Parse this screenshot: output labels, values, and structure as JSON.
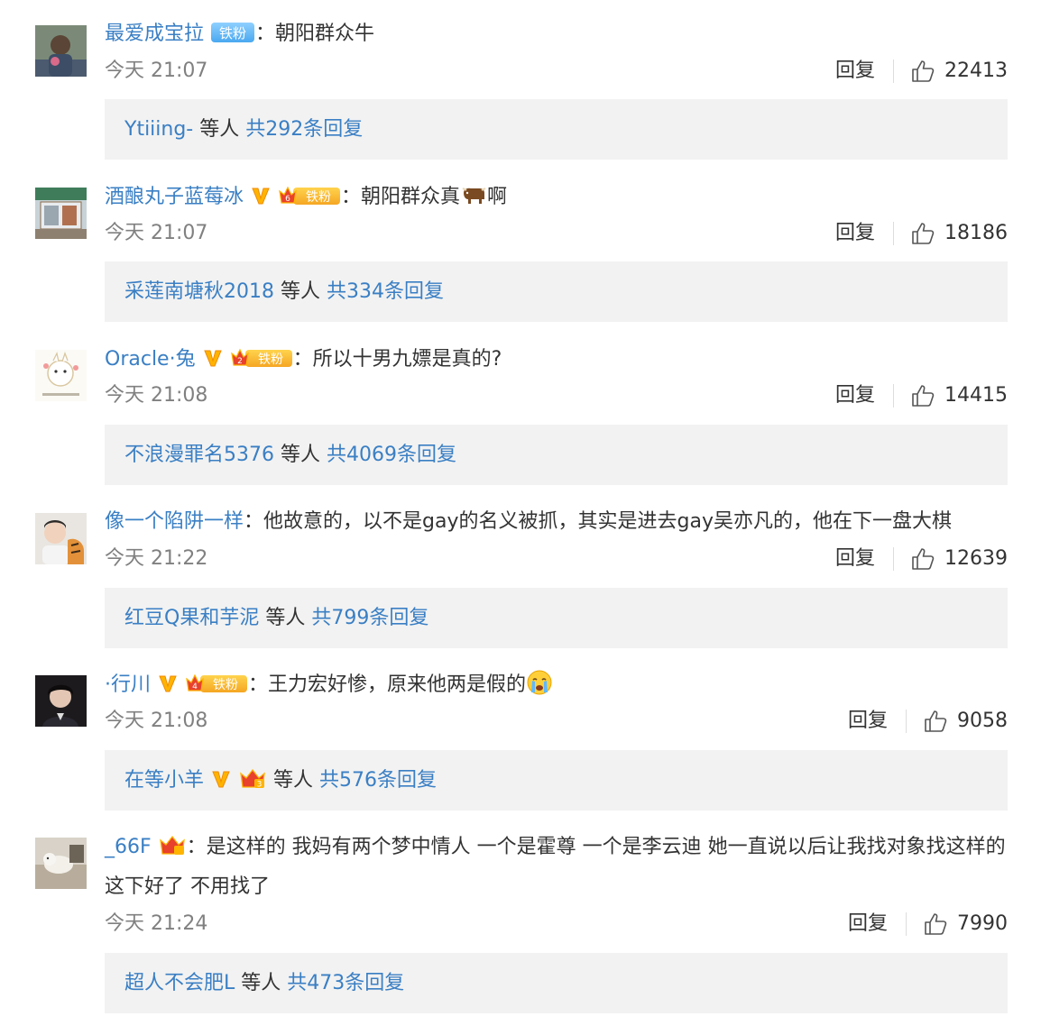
{
  "reply_label": "回复",
  "comments": [
    {
      "user": "最爱成宝拉",
      "badges": [
        "铁粉"
      ],
      "colon": "：",
      "content": "朝阳群众牛",
      "time": "今天 21:07",
      "likes": "22413",
      "sub_users": "Ytiiing-",
      "sub_mid": " 等人 ",
      "sub_total": "共292条回复"
    },
    {
      "user": "酒酿丸子蓝莓冰",
      "badges": [
        "V",
        "6",
        "铁粉"
      ],
      "colon": "：",
      "content": "朝阳群众真",
      "content_tail": "啊",
      "emoji": "bull",
      "time": "今天 21:07",
      "likes": "18186",
      "sub_users": "采莲南塘秋2018",
      "sub_mid": " 等人 ",
      "sub_total": "共334条回复"
    },
    {
      "user": "Oracle·兔",
      "badges": [
        "V",
        "2",
        "铁粉"
      ],
      "colon": "：",
      "content": "所以十男九嫖是真的?",
      "time": "今天 21:08",
      "likes": "14415",
      "sub_users": "不浪漫罪名5376",
      "sub_mid": " 等人 ",
      "sub_total": "共4069条回复"
    },
    {
      "user": "像一个陷阱一样",
      "badges": [],
      "colon": "：",
      "content": "他故意的，以不是gay的名义被抓，其实是进去gay吴亦凡的，他在下一盘大棋",
      "time": "今天 21:22",
      "likes": "12639",
      "sub_users": "红豆Q果和芋泥",
      "sub_mid": " 等人 ",
      "sub_total": "共799条回复"
    },
    {
      "user": "·行川",
      "badges": [
        "V",
        "4",
        "铁粉"
      ],
      "colon": "：",
      "content": "王力宏好惨，原来他两是假的",
      "emoji": "crying-face",
      "time": "今天 21:08",
      "likes": "9058",
      "sub_users": "在等小羊",
      "sub_badges": [
        "V",
        "3"
      ],
      "sub_mid": " 等人 ",
      "sub_total": "共576条回复"
    },
    {
      "user": "_66F",
      "badges": [
        "crown"
      ],
      "colon": "：",
      "content": "是这样的 我妈有两个梦中情人 一个是霍尊 一个是李云迪 她一直说以后让我找对象找这样的 这下好了 不用找了",
      "time": "今天 21:24",
      "likes": "7990",
      "sub_users": "超人不会肥L",
      "sub_mid": " 等人 ",
      "sub_total": "共473条回复"
    }
  ]
}
